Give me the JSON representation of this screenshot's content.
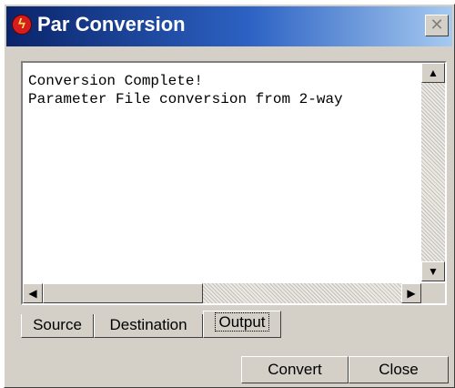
{
  "window": {
    "title": "Par Conversion",
    "app_icon_glyph": "ϟ",
    "close_glyph": "✕",
    "icon_names": [
      "app-icon",
      "close-icon"
    ]
  },
  "output": {
    "line1": "Conversion Complete!",
    "line2": "Parameter File conversion from 2-way"
  },
  "scroll": {
    "up_glyph": "▲",
    "down_glyph": "▼",
    "left_glyph": "◀",
    "right_glyph": "▶"
  },
  "tabs": [
    {
      "label": "Source",
      "active": false
    },
    {
      "label": "Destination",
      "active": false
    },
    {
      "label": "Output",
      "active": true
    }
  ],
  "buttons": {
    "convert": "Convert",
    "close": "Close"
  },
  "colors": {
    "title_gradient_start": "#0a246a",
    "title_gradient_end": "#a6caf0",
    "face": "#d4d0c8"
  }
}
